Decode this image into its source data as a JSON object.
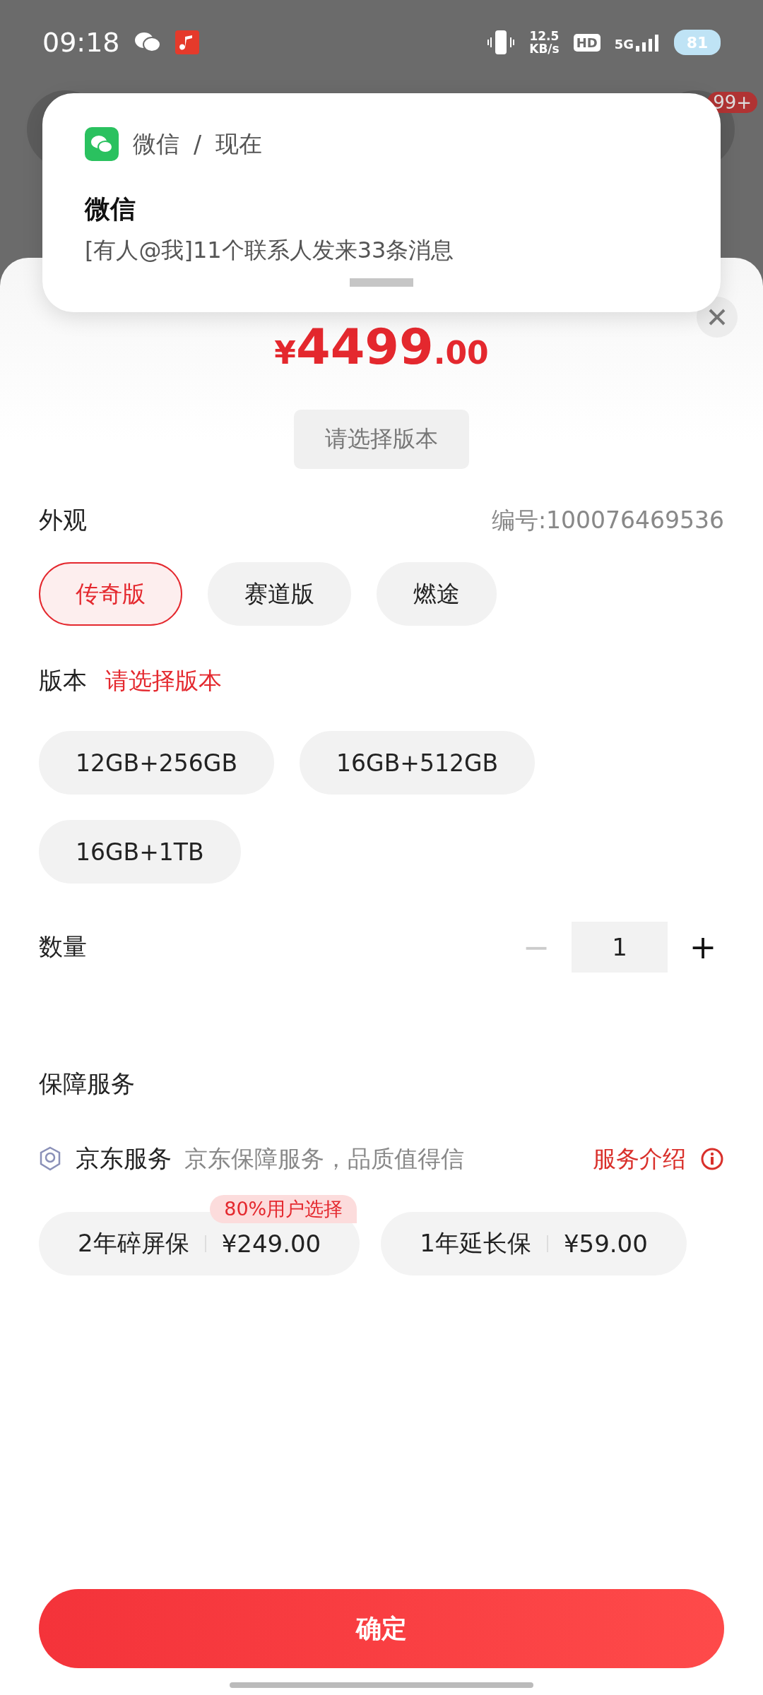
{
  "status_bar": {
    "time": "09:18",
    "speed": "12.5",
    "speed_unit": "KB/s",
    "hd": "HD",
    "network": "5G",
    "battery": "81"
  },
  "background": {
    "badge": "99+"
  },
  "notification": {
    "app": "微信",
    "separator": "/",
    "time": "现在",
    "title": "微信",
    "message": "[有人@我]11个联系人发来33条消息"
  },
  "price": {
    "symbol": "¥",
    "integer": "4499",
    "decimal": ".00"
  },
  "version_button": "请选择版本",
  "appearance": {
    "label": "外观",
    "sku": "编号:100076469536",
    "options": [
      {
        "label": "传奇版",
        "selected": true
      },
      {
        "label": "赛道版",
        "selected": false
      },
      {
        "label": "燃途",
        "selected": false
      }
    ]
  },
  "version": {
    "label": "版本",
    "hint": "请选择版本",
    "options": [
      {
        "label": "12GB+256GB",
        "selected": false
      },
      {
        "label": "16GB+512GB",
        "selected": false
      },
      {
        "label": "16GB+1TB",
        "selected": false
      }
    ]
  },
  "quantity": {
    "label": "数量",
    "minus": "−",
    "value": "1",
    "plus": "+",
    "minus_disabled": true
  },
  "services": {
    "title": "保障服务",
    "provider": "京东服务",
    "description": "京东保障服务，品质值得信",
    "link": "服务介绍",
    "options": [
      {
        "name": "2年碎屏保",
        "price": "¥249.00",
        "badge": "80%用户选择",
        "selected": false
      },
      {
        "name": "1年延长保",
        "price": "¥59.00",
        "selected": false
      }
    ]
  },
  "confirm": "确定"
}
